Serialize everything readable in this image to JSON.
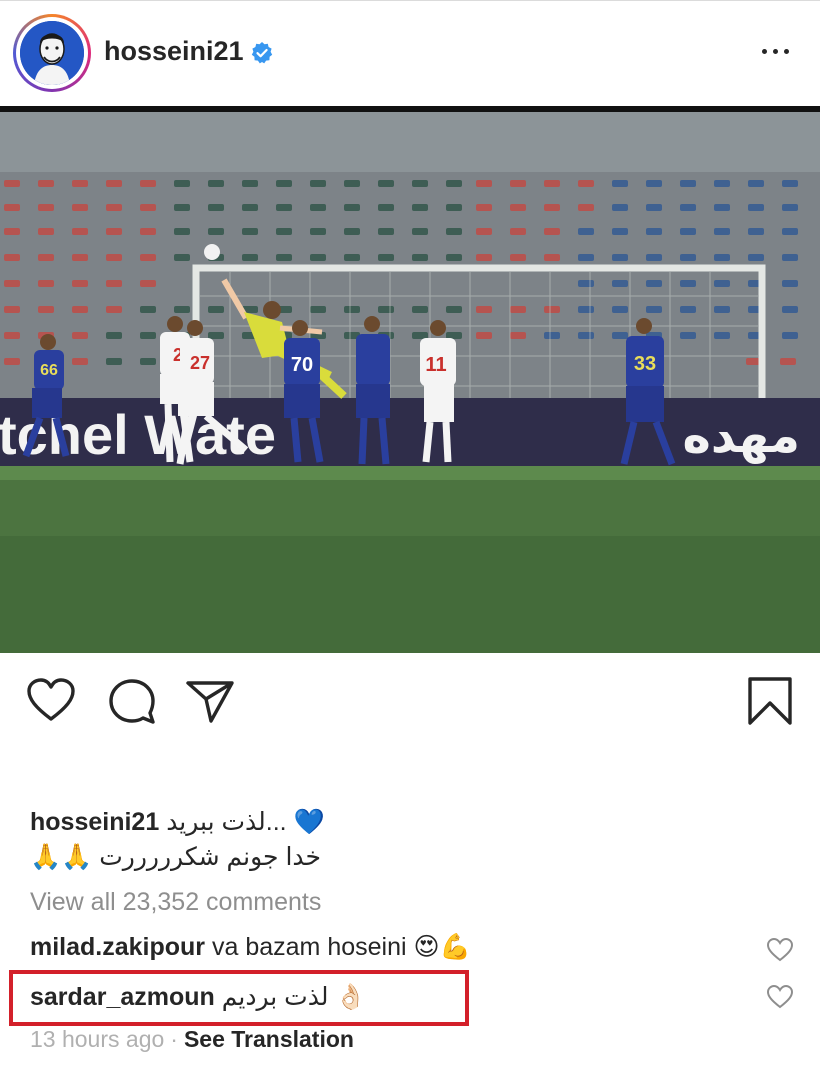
{
  "post": {
    "author": "hosseini21",
    "verified": true
  },
  "caption": {
    "user": "hosseini21",
    "line1": "...لذت ببرید",
    "line1_emoji": "💙",
    "line2": "خدا جونم شکرررررت",
    "line2_emoji": "🙏🙏"
  },
  "comments_link": "View all 23,352 comments",
  "comments": [
    {
      "user": "milad.zakipour",
      "text": "va bazam hoseini",
      "emoji": "😍💪"
    },
    {
      "user": "sardar_azmoun",
      "text": "لذت بردیم",
      "emoji": "👌🏻"
    }
  ],
  "comment_meta": {
    "time_ago": "13 hours ago",
    "see_translation": "See Translation"
  },
  "photo": {
    "player_numbers": [
      "66",
      "2",
      "27",
      "70",
      "11",
      "33"
    ],
    "banner_text": "tchel Wate",
    "banner_text_right": "مهده"
  },
  "icons": {
    "like": "heart-icon",
    "comment": "comment-bubble-icon",
    "share": "paper-plane-icon",
    "save": "bookmark-icon",
    "more": "more-dots-icon",
    "verified": "verified-badge-icon"
  },
  "colors": {
    "highlight_box": "#d3202a",
    "verified_blue": "#3897f0",
    "muted_text": "#8e8e8e"
  }
}
